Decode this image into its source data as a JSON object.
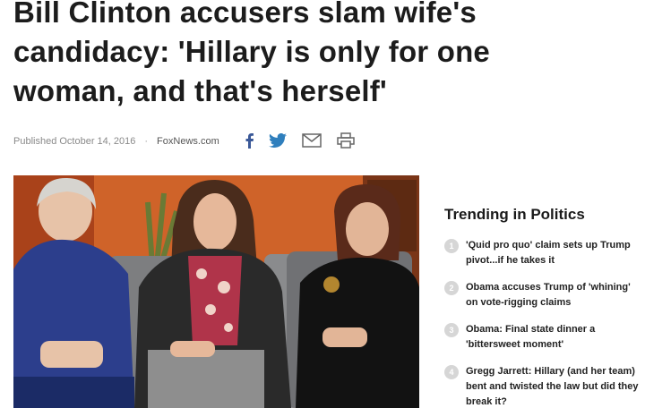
{
  "article": {
    "headline": "Bill Clinton accusers slam wife's candidacy: 'Hillary is only for one woman, and that's herself'",
    "published": "Published October 14, 2016",
    "separator": "·",
    "source": "FoxNews.com"
  },
  "share": {
    "icons": [
      "facebook-icon",
      "twitter-icon",
      "email-icon",
      "print-icon"
    ],
    "brand_color": "#3b5998"
  },
  "video": {
    "description_colors": {
      "background": "#d4672a",
      "chair": "#8a8b8d"
    }
  },
  "sidebar": {
    "title": "Trending in Politics",
    "items": [
      {
        "num": "1",
        "text": "'Quid pro quo' claim sets up Trump pivot...if he takes it"
      },
      {
        "num": "2",
        "text": "Obama accuses Trump of 'whining' on vote-rigging claims"
      },
      {
        "num": "3",
        "text": "Obama: Final state dinner a 'bittersweet moment'"
      },
      {
        "num": "4",
        "text": "Gregg Jarrett: Hillary (and her team) bent and twisted the law but did they break it?"
      }
    ]
  }
}
